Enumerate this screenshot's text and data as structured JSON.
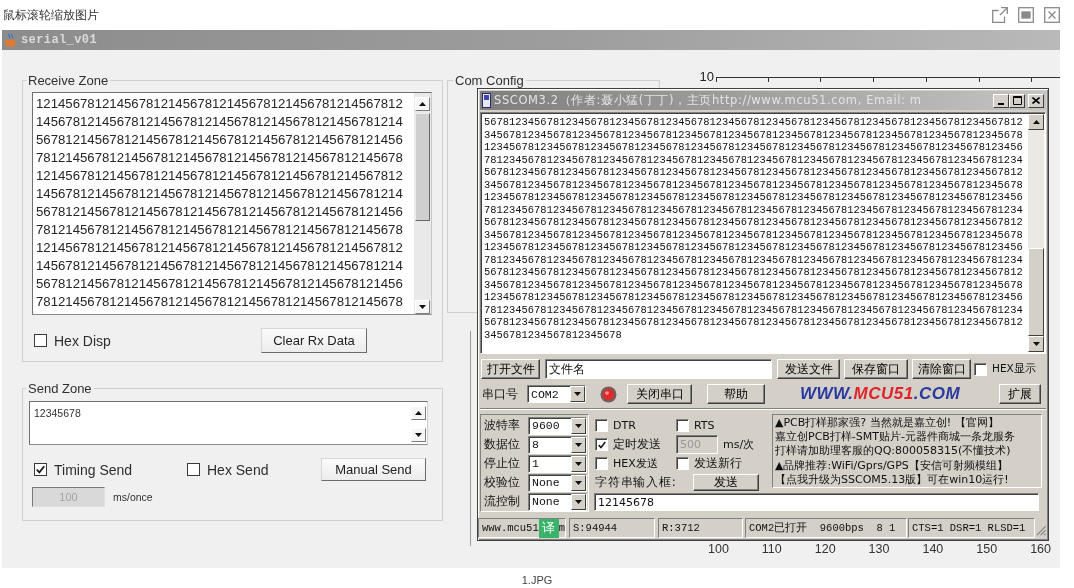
{
  "viewer": {
    "caption": "鼠标滚轮缩放图片",
    "file_name": "1.JPG"
  },
  "app_window": {
    "title": "serial_v01",
    "receive_zone": {
      "title": "Receive Zone",
      "lines": [
        "12145678121456781214567812145678121456781214567812",
        "14567812145678121456781214567812145678121456781214",
        "56781214567812145678121456781214567812145678121456",
        "78121456781214567812145678121456781214567812145678",
        "12145678121456781214567812145678121456781214567812",
        "14567812145678121456781214567812145678121456781214",
        "56781214567812145678121456781214567812145678121456",
        "78121456781214567812145678121456781214567812145678",
        "12145678121456781214567812145678121456781214567812",
        "14567812145678121456781214567812145678121456781214",
        "56781214567812145678121456781214567812145678121456",
        "78121456781214567812145678121456781214567812145678"
      ],
      "hex_disp": {
        "label": "Hex Disp",
        "checked": false
      },
      "clear_button": "Clear Rx Data"
    },
    "send_zone": {
      "title": "Send Zone",
      "value": "12345678",
      "timing_send": {
        "label": "Timing Send",
        "checked": true
      },
      "hex_send": {
        "label": "Hex Send",
        "checked": false
      },
      "manual_send_button": "Manual Send",
      "interval": {
        "value": "100",
        "disabled": true
      },
      "interval_unit": "ms/once"
    },
    "com_config": {
      "title": "Com Config"
    },
    "plot": {
      "y_tick_label": "10",
      "x_tick_labels": [
        "100",
        "110",
        "120",
        "130",
        "140",
        "150",
        "160"
      ]
    }
  },
  "sscom_window": {
    "title": "SSCOM3.2（作者:聂小猛(丁丁)，主页http://www.mcu51.com,  Email: m",
    "lines": [
      "56781234567812345678123456781234567812345678123456781234567812345678123456781234567812",
      "34567812345678123456781234567812345678123456781234567812345678123456781234567812345678",
      "12345678123456781234567812345678123456781234567812345678123456781234567812345678123456",
      "78123456781234567812345678123456781234567812345678123456781234567812345678123456781234",
      "56781234567812345678123456781234567812345678123456781234567812345678123456781234567812",
      "34567812345678123456781234567812345678123456781234567812345678123456781234567812345678",
      "12345678123456781234567812345678123456781234567812345678123456781234567812345678123456",
      "78123456781234567812345678123456781234567812345678123456781234567812345678123456781234",
      "56781234567812345678123456781234567812345678123456781234567812345678123456781234567812",
      "34567812345678123456781234567812345678123456781234567812345678123456781234567812345678",
      "12345678123456781234567812345678123456781234567812345678123456781234567812345678123456",
      "78123456781234567812345678123456781234567812345678123456781234567812345678123456781234",
      "56781234567812345678123456781234567812345678123456781234567812345678123456781234567812",
      "34567812345678123456781234567812345678123456781234567812345678123456781234567812345678",
      "12345678123456781234567812345678123456781234567812345678123456781234567812345678123456",
      "78123456781234567812345678123456781234567812345678123456781234567812345678123456781234",
      "56781234567812345678123456781234567812345678123456781234567812345678123456781234567812",
      "3456781234567812345678"
    ],
    "file_row": {
      "open_file_button": "打开文件",
      "file_name": "文件名",
      "buttons": [
        "发送文件",
        "保存窗口",
        "清除窗口"
      ],
      "hex_display": {
        "label": "HEX显示",
        "checked": false
      }
    },
    "port_row": {
      "label": "串口号",
      "port": "COM2",
      "port_open": true,
      "toggle_button": "关闭串口",
      "help_button": "帮助",
      "logo": [
        {
          "text": "WWW.",
          "color": "#2b3a9e"
        },
        {
          "text": "MCU51",
          "color": "#e0242c"
        },
        {
          "text": ".COM",
          "color": "#2b3a9e"
        }
      ],
      "expand_button": "扩展"
    },
    "settings": [
      {
        "label": "波特率",
        "value": "9600"
      },
      {
        "label": "数据位",
        "value": "8"
      },
      {
        "label": "停止位",
        "value": "1"
      },
      {
        "label": "校验位",
        "value": "None"
      },
      {
        "label": "流控制",
        "value": "None"
      }
    ],
    "dtr": {
      "label": "DTR",
      "checked": false
    },
    "rts": {
      "label": "RTS",
      "checked": false
    },
    "timed_send": {
      "label": "定时发送",
      "checked": true
    },
    "period": {
      "value": "500",
      "disabled": true
    },
    "period_unit": "ms/次",
    "hex_send": {
      "label": "HEX发送",
      "checked": false
    },
    "send_newline": {
      "label": "发送新行",
      "checked": false
    },
    "input_label": "字符串输入框:",
    "send_button": "发送",
    "input_value": "12145678",
    "ad_lines": [
      "▲PCB打样那家强? 当然就是嘉立创! 【官网】",
      "嘉立创PCB打样-SMT贴片-元器件商城一条龙服务",
      "打样请加助理客服的QQ:800058315(不懂技术)",
      "▲品牌推荐:WiFi/Gprs/GPS【安信可射频模组】",
      "【点我升级为SSCOM5.13版】可在win10运行!"
    ],
    "status_bar": {
      "site": "www.mcu51",
      "translate_badge": "译",
      "site_tail": "m",
      "sent": "S:94944",
      "received": "R:3712",
      "port_state": "COM2已打开  9600bps  8 1",
      "line_state": "CTS=1 DSR=1 RLSD=1"
    }
  }
}
